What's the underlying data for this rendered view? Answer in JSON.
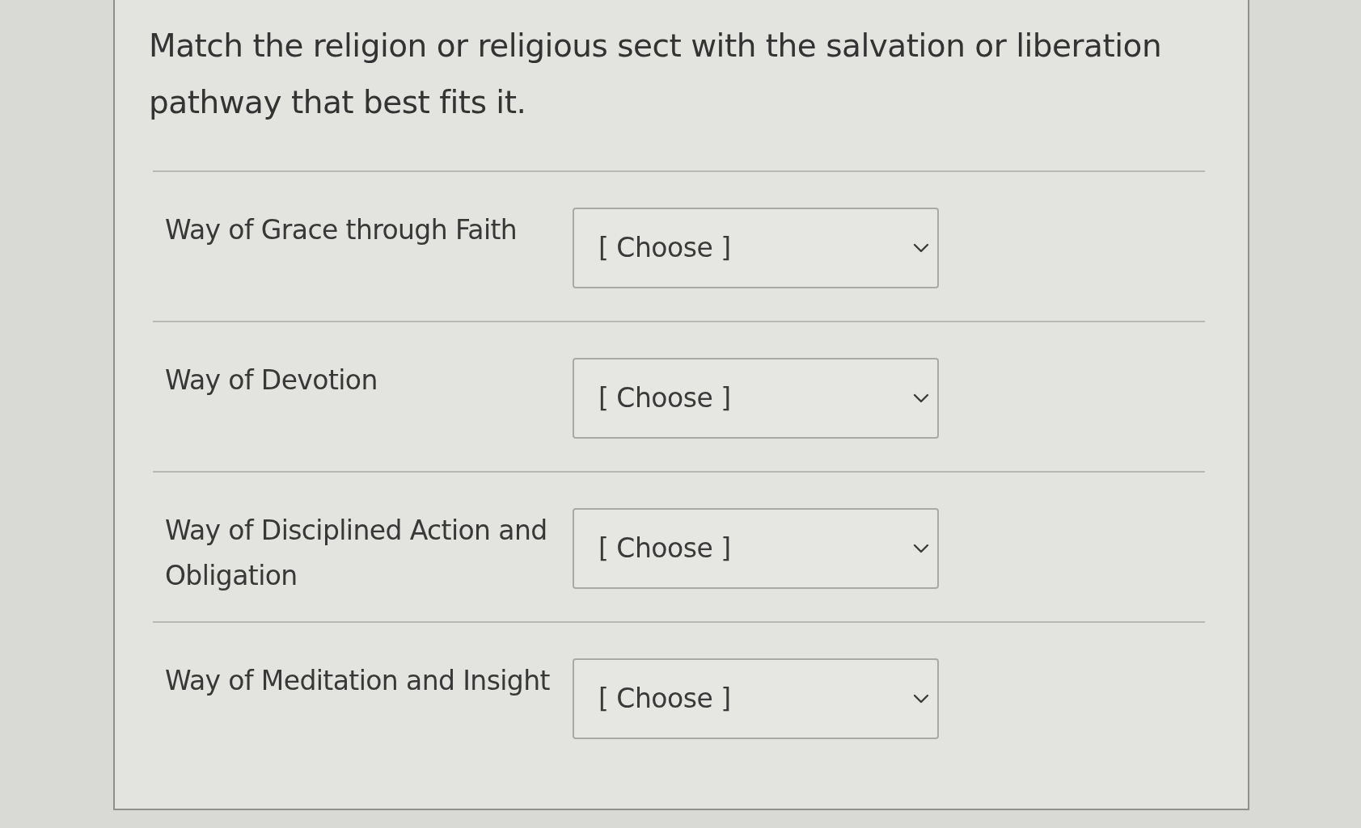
{
  "question": "Match the religion or religious sect with the salvation or liberation pathway that best fits it.",
  "rows": [
    {
      "label": "Way of Grace through Faith",
      "select": {
        "value": "[ Choose ]"
      }
    },
    {
      "label": "Way of Devotion",
      "select": {
        "value": "[ Choose ]"
      }
    },
    {
      "label": "Way of Disciplined Action and Obligation",
      "select": {
        "value": "[ Choose ]"
      }
    },
    {
      "label": "Way of Meditation and Insight",
      "select": {
        "value": "[ Choose ]"
      }
    }
  ]
}
